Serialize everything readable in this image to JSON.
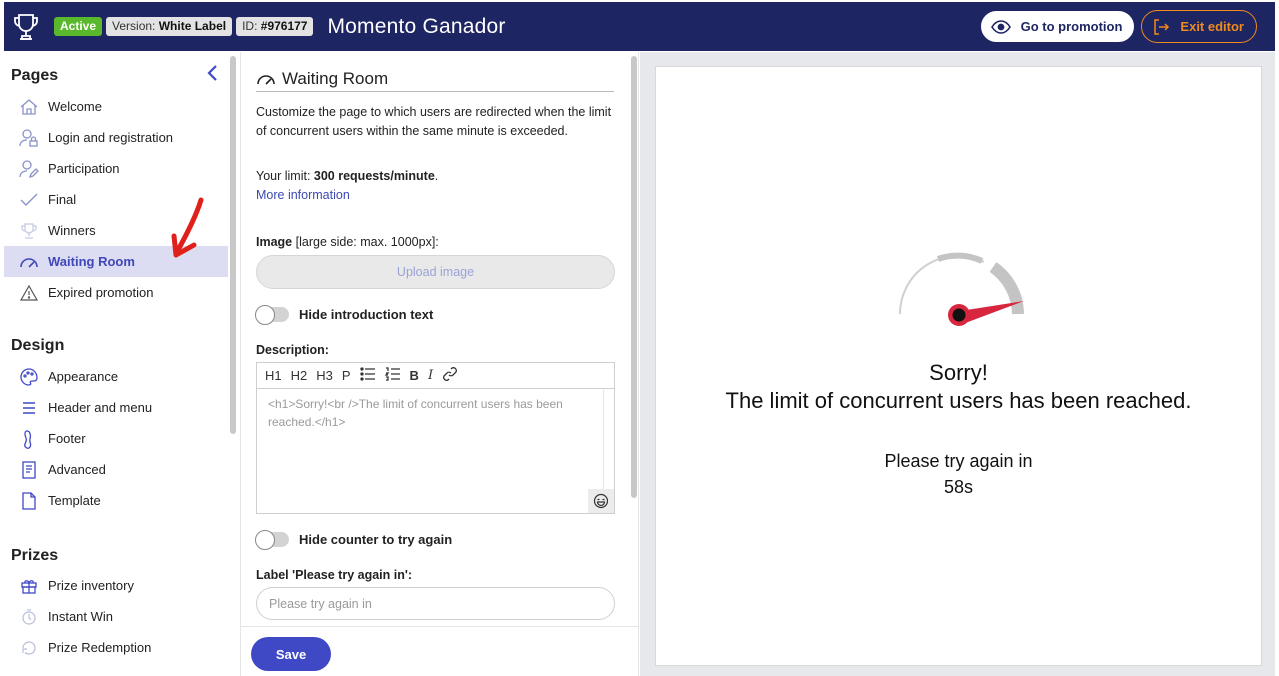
{
  "header": {
    "status_badge": "Active",
    "version_label": "Version:",
    "version_value": "White Label",
    "id_label": "ID:",
    "id_value": "#976177",
    "app_title": "Momento Ganador",
    "go_to_promotion": "Go to promotion",
    "exit_editor": "Exit editor"
  },
  "sidebar": {
    "pages_title": "Pages",
    "pages": [
      {
        "label": "Welcome",
        "icon": "home-icon"
      },
      {
        "label": "Login and registration",
        "icon": "user-lock-icon"
      },
      {
        "label": "Participation",
        "icon": "user-edit-icon"
      },
      {
        "label": "Final",
        "icon": "check-icon"
      },
      {
        "label": "Winners",
        "icon": "trophy-icon"
      },
      {
        "label": "Waiting Room",
        "icon": "speedometer-icon",
        "selected": true
      },
      {
        "label": "Expired promotion",
        "icon": "warning-icon"
      }
    ],
    "design_title": "Design",
    "design": [
      {
        "label": "Appearance",
        "icon": "palette-icon"
      },
      {
        "label": "Header and menu",
        "icon": "menu-icon"
      },
      {
        "label": "Footer",
        "icon": "foot-icon"
      },
      {
        "label": "Advanced",
        "icon": "code-file-icon"
      },
      {
        "label": "Template",
        "icon": "file-icon"
      }
    ],
    "prizes_title": "Prizes",
    "prizes": [
      {
        "label": "Prize inventory",
        "icon": "gift-icon"
      },
      {
        "label": "Instant Win",
        "icon": "instant-win-icon"
      },
      {
        "label": "Prize Redemption",
        "icon": "redemption-icon"
      }
    ]
  },
  "editor": {
    "title": "Waiting Room",
    "description": "Customize the page to which users are redirected when the limit of concurrent users within the same minute is exceeded.",
    "limit_prefix": "Your limit: ",
    "limit_value": "300 requests/minute",
    "limit_suffix": ".",
    "more_info": "More information",
    "image_label": "Image",
    "image_hint": "[large side: max. 1000px]:",
    "upload_button": "Upload image",
    "hide_intro_label": "Hide introduction text",
    "description_label": "Description:",
    "toolbar": [
      "H1",
      "H2",
      "H3",
      "P"
    ],
    "description_value": "<h1>Sorry!<br />The limit of concurrent users has been reached.</h1>",
    "hide_counter_label": "Hide counter to try again",
    "try_again_field_label": "Label 'Please try again in':",
    "try_again_placeholder": "Please try again in",
    "save_button": "Save"
  },
  "preview": {
    "sorry": "Sorry!",
    "message": "The limit of concurrent users has been reached.",
    "try_again": "Please try again in",
    "countdown": "58s"
  },
  "colors": {
    "header_bg": "#1e2563",
    "accent": "#3f48c5",
    "active_badge": "#5ab82d",
    "exit_orange": "#f08a1c",
    "gauge_red": "#d7263d"
  }
}
